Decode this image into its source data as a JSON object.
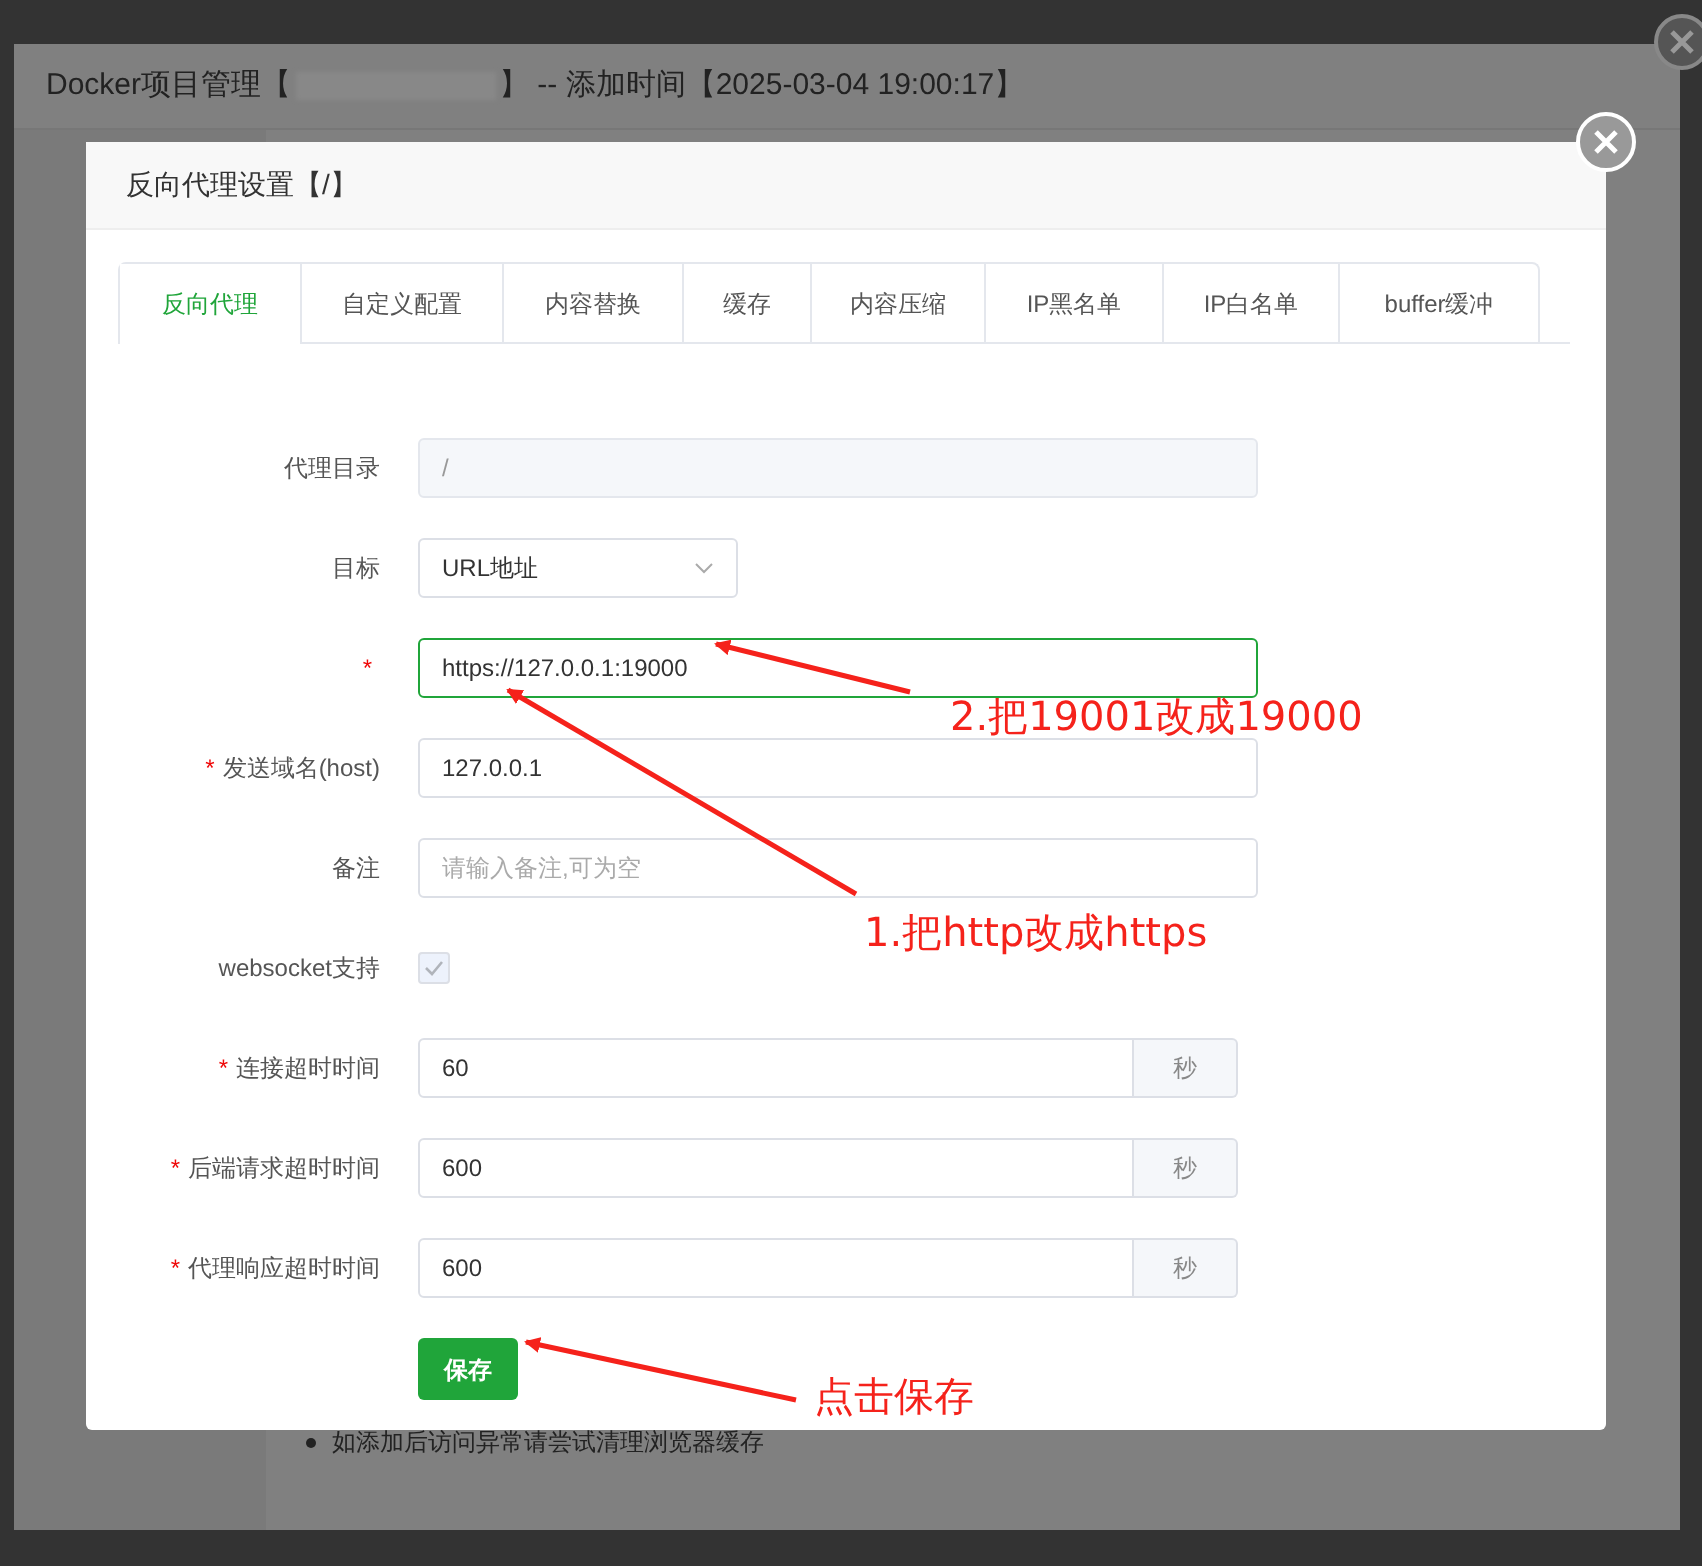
{
  "background_window": {
    "title_prefix": "Docker项目管理【",
    "title_suffix": "】 -- 添加时间【2025-03-04 19:00:17】",
    "notes": [
      "如添加后访问异常请尝试清理浏览器缓存"
    ]
  },
  "dialog": {
    "title": "反向代理设置【/】",
    "tabs": [
      {
        "label": "反向代理",
        "selected": true
      },
      {
        "label": "自定义配置",
        "selected": false
      },
      {
        "label": "内容替换",
        "selected": false
      },
      {
        "label": "缓存",
        "selected": false
      },
      {
        "label": "内容压缩",
        "selected": false
      },
      {
        "label": "IP黑名单",
        "selected": false
      },
      {
        "label": "IP白名单",
        "selected": false
      },
      {
        "label": "buffer缓冲",
        "selected": false
      }
    ],
    "fields": [
      {
        "kind": "text",
        "label": "代理目录",
        "value": "/",
        "disabled": true
      },
      {
        "kind": "select",
        "label": "目标",
        "value": "URL地址"
      },
      {
        "kind": "text",
        "required_mark": "*",
        "value": "https://127.0.0.1:19000",
        "focused": true
      },
      {
        "kind": "text",
        "required_mark": "*",
        "label": "发送域名(host)",
        "value": "127.0.0.1"
      },
      {
        "kind": "text",
        "label": "备注",
        "placeholder": "请输入备注,可为空"
      },
      {
        "kind": "checkbox",
        "label": "websocket支持",
        "checked": true,
        "disabled": true
      },
      {
        "kind": "addon",
        "required_mark": "*",
        "label": "连接超时时间",
        "value": "60",
        "unit": "秒"
      },
      {
        "kind": "addon",
        "required_mark": "*",
        "label": "后端请求超时时间",
        "value": "600",
        "unit": "秒"
      },
      {
        "kind": "addon",
        "required_mark": "*",
        "label": "代理响应超时时间",
        "value": "600",
        "unit": "秒"
      }
    ],
    "save_button": "保存"
  },
  "annotations": [
    {
      "text": "2.把19001改成19000"
    },
    {
      "text": "1.把http改成https"
    },
    {
      "text": "点击保存"
    }
  ]
}
